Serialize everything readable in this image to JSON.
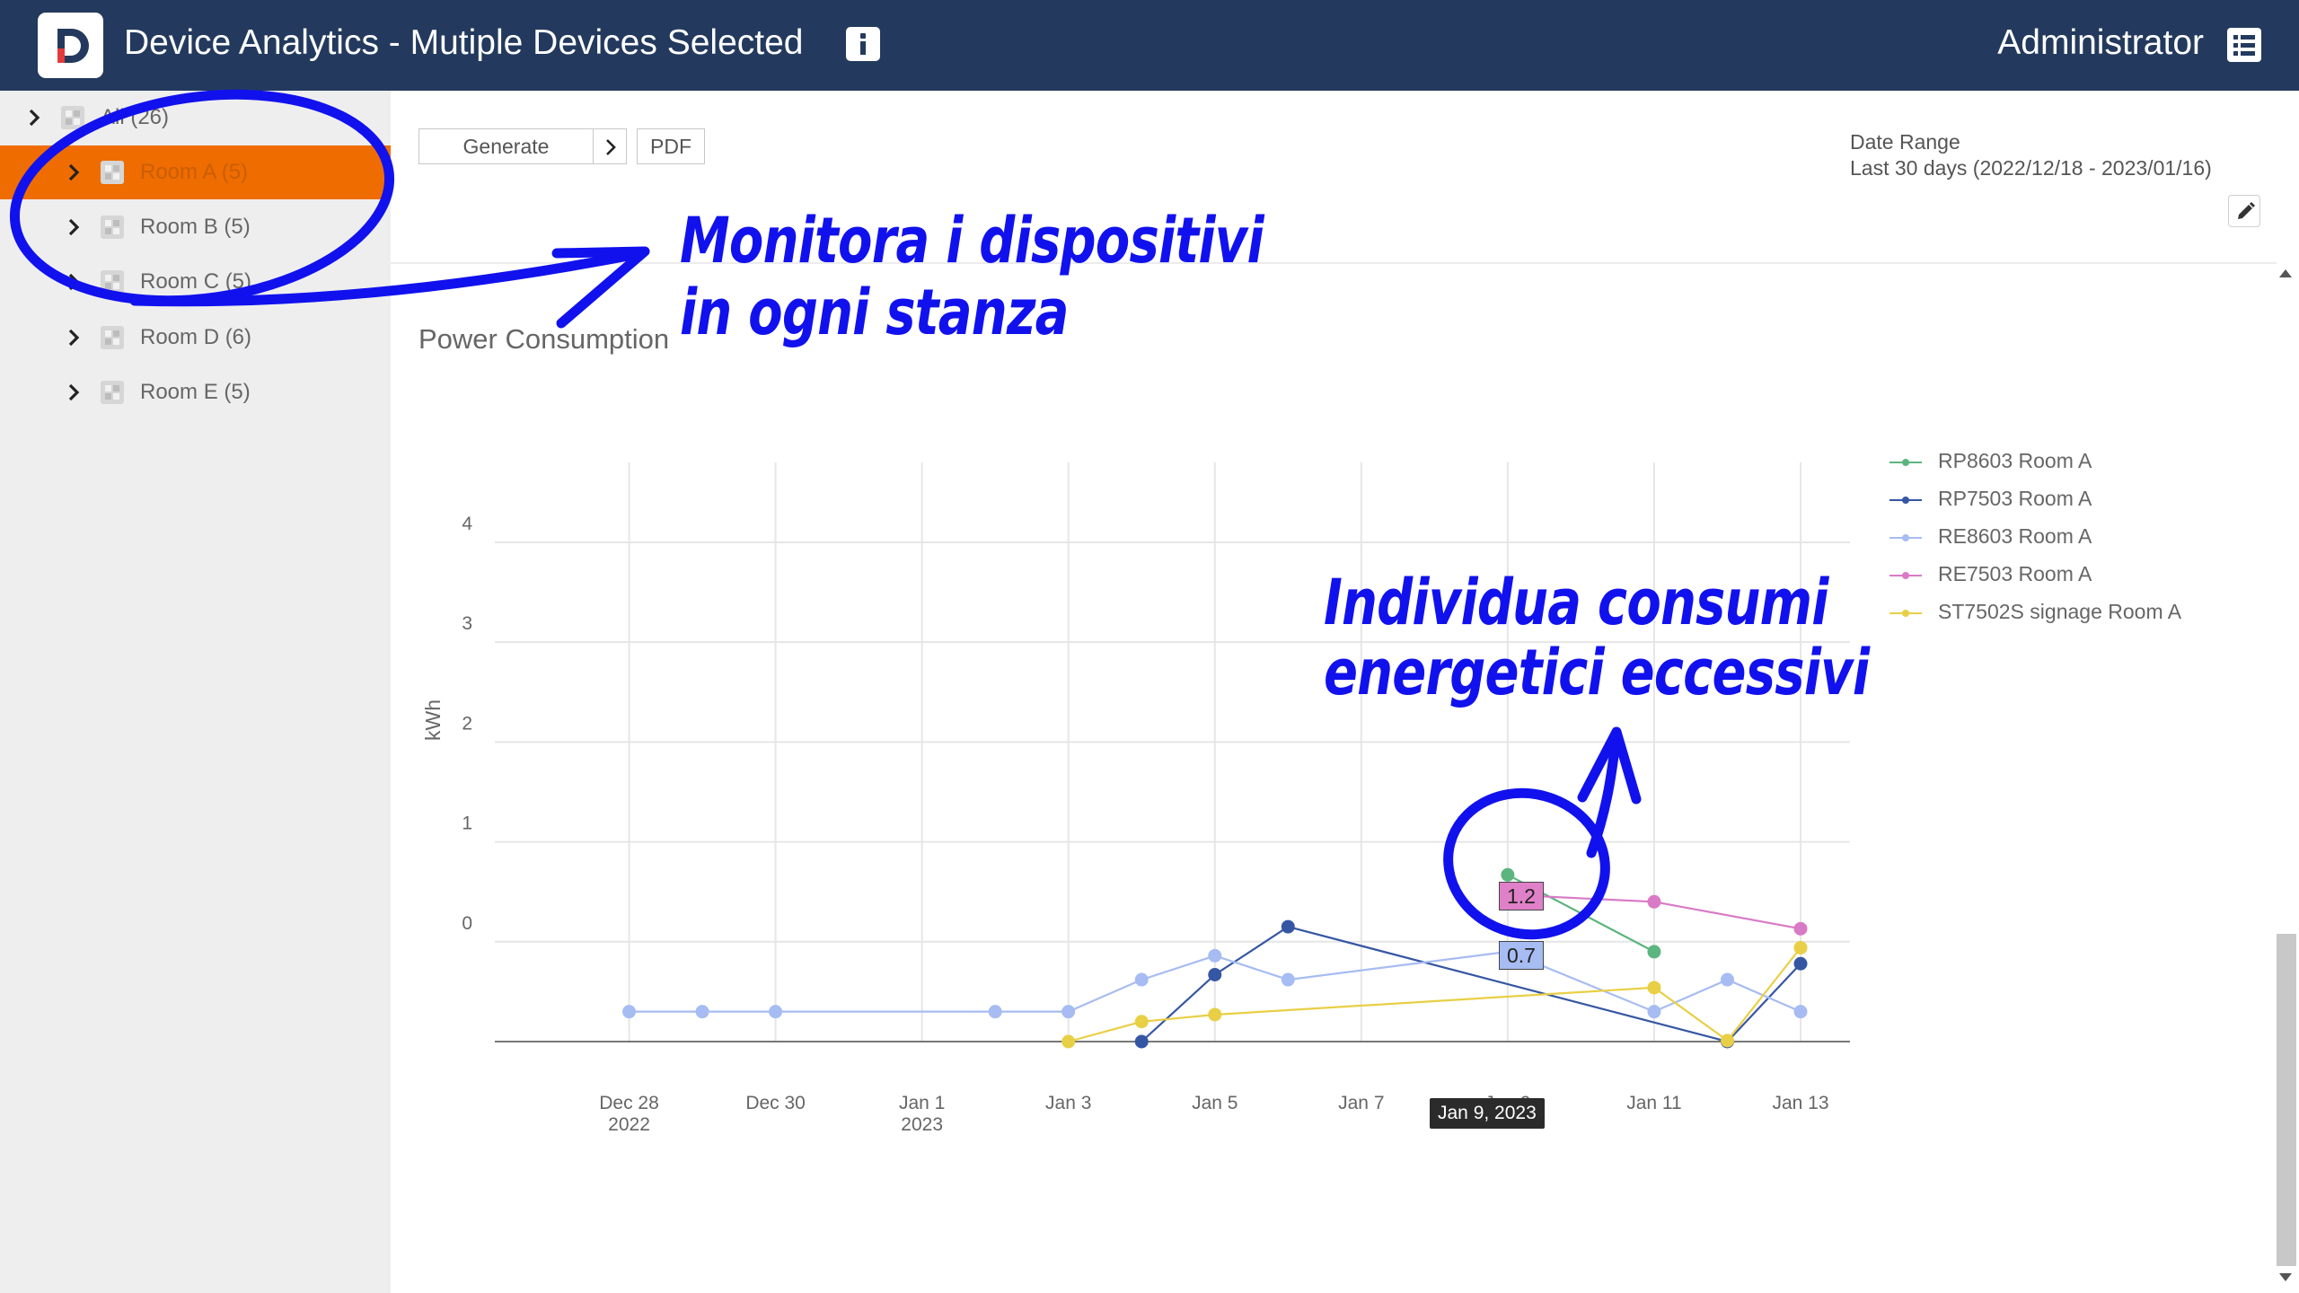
{
  "header": {
    "logo_letter": "D",
    "title": "Device Analytics - Mutiple Devices Selected",
    "user": "Administrator"
  },
  "sidebar": {
    "root": {
      "label": "All (26)"
    },
    "items": [
      {
        "label": "Room A (5)",
        "selected": true
      },
      {
        "label": "Room B (5)",
        "selected": false
      },
      {
        "label": "Room C (5)",
        "selected": false
      },
      {
        "label": "Room D (6)",
        "selected": false
      },
      {
        "label": "Room E (5)",
        "selected": false
      }
    ]
  },
  "toolbar": {
    "generate_label": "Generate",
    "pdf_label": "PDF",
    "date_range_label": "Date Range",
    "date_range_value": "Last 30 days (2022/12/18 - 2023/01/16)"
  },
  "chart_title": "Power Consumption",
  "colors": {
    "header_bg": "#233a5e",
    "selected_bg": "#ef6c00",
    "annotation": "#1111ee"
  },
  "chart_data": {
    "type": "line",
    "title": "Power Consumption",
    "xlabel": "",
    "ylabel": "kWh",
    "x_range": [
      "2022-12-27",
      "2023-01-13"
    ],
    "y_range": [
      -1,
      4.8
    ],
    "y_ticks": [
      0,
      1,
      2,
      3,
      4
    ],
    "x_ticks": [
      {
        "date": "2022-12-28",
        "label": "Dec 28",
        "sublabel": "2022"
      },
      {
        "date": "2022-12-30",
        "label": "Dec 30",
        "sublabel": ""
      },
      {
        "date": "2023-01-01",
        "label": "Jan 1",
        "sublabel": "2023"
      },
      {
        "date": "2023-01-03",
        "label": "Jan 3",
        "sublabel": ""
      },
      {
        "date": "2023-01-05",
        "label": "Jan 5",
        "sublabel": ""
      },
      {
        "date": "2023-01-07",
        "label": "Jan 7",
        "sublabel": ""
      },
      {
        "date": "2023-01-09",
        "label": "Jan 9",
        "sublabel": ""
      },
      {
        "date": "2023-01-11",
        "label": "Jan 11",
        "sublabel": ""
      },
      {
        "date": "2023-01-13",
        "label": "Jan 13",
        "sublabel": ""
      }
    ],
    "grid": true,
    "legend_position": "right",
    "series": [
      {
        "name": "RP8603 Room A",
        "color": "#5cb57e",
        "points": [
          [
            "2023-01-09",
            0.67
          ],
          [
            "2023-01-11",
            -0.1
          ]
        ]
      },
      {
        "name": "RP7503 Room A",
        "color": "#3556a3",
        "points": [
          [
            "2023-01-04",
            -1.0
          ],
          [
            "2023-01-05",
            -0.33
          ],
          [
            "2023-01-06",
            0.15
          ],
          [
            "2023-01-12",
            -1.0
          ],
          [
            "2023-01-13",
            -0.22
          ]
        ]
      },
      {
        "name": "RE8603 Room A",
        "color": "#a6bcf2",
        "points": [
          [
            "2022-12-28",
            -0.7
          ],
          [
            "2022-12-29",
            -0.7
          ],
          [
            "2022-12-30",
            -0.7
          ],
          [
            "2023-01-02",
            -0.7
          ],
          [
            "2023-01-03",
            -0.7
          ],
          [
            "2023-01-04",
            -0.38
          ],
          [
            "2023-01-05",
            -0.14
          ],
          [
            "2023-01-06",
            -0.38
          ],
          [
            "2023-01-09",
            -0.1
          ],
          [
            "2023-01-11",
            -0.7
          ],
          [
            "2023-01-12",
            -0.38
          ],
          [
            "2023-01-13",
            -0.7
          ]
        ]
      },
      {
        "name": "RE7503 Room A",
        "color": "#d97ac6",
        "points": [
          [
            "2023-01-09",
            0.47
          ],
          [
            "2023-01-11",
            0.4
          ],
          [
            "2023-01-13",
            0.13
          ]
        ]
      },
      {
        "name": "ST7502S signage Room A",
        "color": "#e9cf45",
        "points": [
          [
            "2023-01-03",
            -1.0
          ],
          [
            "2023-01-04",
            -0.8
          ],
          [
            "2023-01-05",
            -0.73
          ],
          [
            "2023-01-11",
            -0.46
          ],
          [
            "2023-01-12",
            -0.99
          ],
          [
            "2023-01-13",
            -0.06
          ]
        ]
      }
    ],
    "tooltips": [
      {
        "series": "RE7503 Room A",
        "value": "1.2"
      },
      {
        "series": "RE8603 Room A",
        "value": "0.7"
      }
    ],
    "hover_date": "Jan 9, 2023"
  },
  "annotations": {
    "devices_note_line1": "Monitora i dispositivi",
    "devices_note_line2": "in ogni stanza",
    "energy_note_line1": "Individua consumi",
    "energy_note_line2": "energetici eccessivi"
  }
}
